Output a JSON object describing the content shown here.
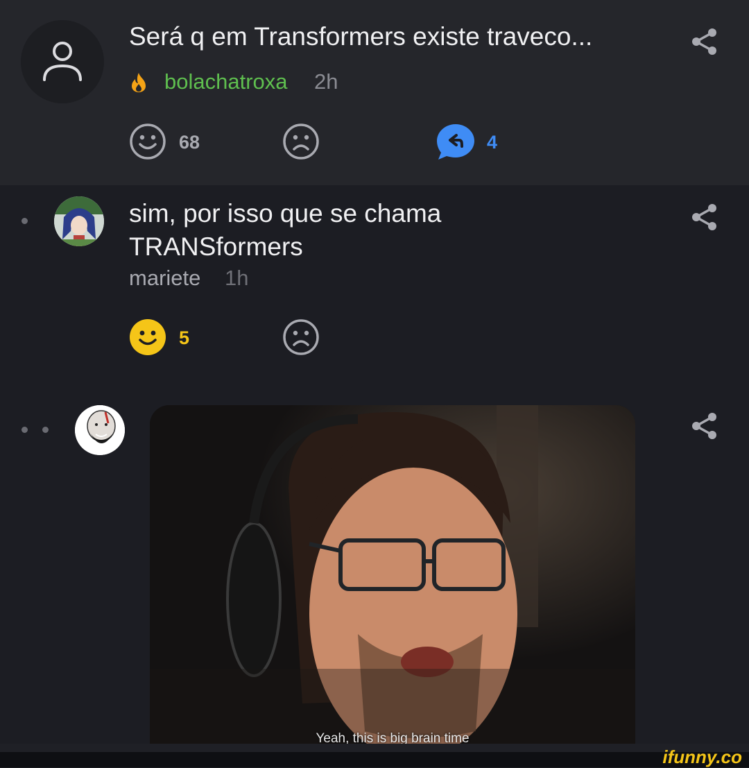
{
  "post": {
    "title": "Será q em Transformers existe traveco...",
    "author": "bolachatroxa",
    "time": "2h",
    "smile_count": "68",
    "reply_count": "4"
  },
  "reply": {
    "text_line1": "sim, por isso que se chama",
    "text_line2": "TRANSformers",
    "author": "mariete",
    "time": "1h",
    "smile_count": "5"
  },
  "meme": {
    "caption": "Yeah, this is big brain time"
  },
  "watermark": "ifunny.co",
  "colors": {
    "author_green": "#5fbf4f",
    "reply_blue": "#3f8cf5",
    "smile_yellow": "#f5c518"
  }
}
